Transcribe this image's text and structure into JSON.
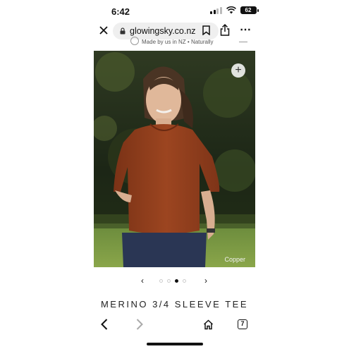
{
  "status_bar": {
    "time": "6:42",
    "battery": "62"
  },
  "browser": {
    "url": "glowingsky.co.nz"
  },
  "header": {
    "tagline": "Made by us in NZ • Naturally"
  },
  "product": {
    "color_label": "Copper",
    "title": "MERINO 3/4 SLEEVE TEE",
    "image_count": 4,
    "active_image": 3
  },
  "toolbar": {
    "tabs_count": "7"
  },
  "icons": [
    "close-icon",
    "lock-icon",
    "bookmark-icon",
    "share-icon",
    "more-icon",
    "plus-icon",
    "chevron-left-icon",
    "chevron-right-icon",
    "back-icon",
    "forward-icon",
    "home-icon",
    "tabs-icon"
  ]
}
